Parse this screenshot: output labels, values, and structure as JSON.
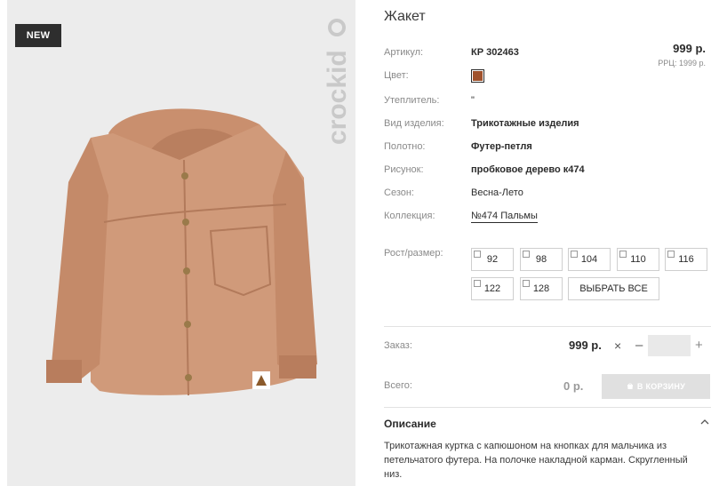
{
  "product": {
    "badge": "NEW",
    "brand": "crockid",
    "title": "Жакет",
    "price": "999 р.",
    "rrp": "РРЦ: 1999 р."
  },
  "attributes": {
    "article": {
      "label": "Артикул:",
      "value": "КР 302463"
    },
    "color": {
      "label": "Цвет:",
      "value": "#a0522d"
    },
    "insulation": {
      "label": "Утеплитель:",
      "value": "\""
    },
    "item_type": {
      "label": "Вид изделия:",
      "value": "Трикотажные изделия"
    },
    "fabric": {
      "label": "Полотно:",
      "value": "Футер-петля"
    },
    "pattern": {
      "label": "Рисунок:",
      "value": "пробковое дерево к474"
    },
    "season": {
      "label": "Сезон:",
      "value": "Весна-Лето"
    },
    "collection": {
      "label": "Коллекция:",
      "value": "№474 Пальмы"
    }
  },
  "sizes": {
    "label": "Рост/размер:",
    "options": [
      "92",
      "98",
      "104",
      "110",
      "116",
      "122",
      "128"
    ],
    "select_all": "ВЫБРАТЬ ВСЕ"
  },
  "order": {
    "label": "Заказ:",
    "price": "999 р.",
    "times": "×",
    "minus": "–",
    "plus": "+",
    "quantity": ""
  },
  "total": {
    "label": "Всего:",
    "value": "0 р.",
    "cart_button": "В КОРЗИНУ"
  },
  "description": {
    "title": "Описание",
    "text": "Трикотажная куртка с капюшоном на кнопках для мальчика из петельчатого футера. На полочке накладной карман. Скругленный низ."
  },
  "colors": {
    "jacket": "#d09a7a",
    "swatch": "#a0522d",
    "badge_bg": "#2e2e2e",
    "cart_button_bg": "#e0e0e0"
  }
}
